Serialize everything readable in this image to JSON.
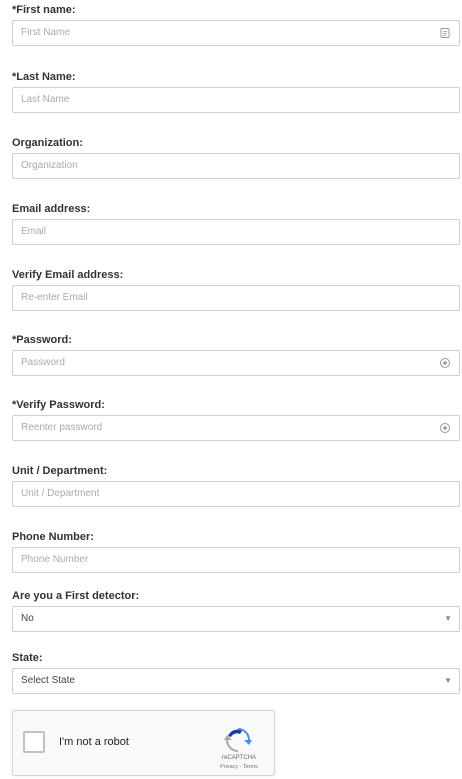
{
  "fields": [
    {
      "label": "*First name:",
      "placeholder": "First Name",
      "icon": "contact-card-icon"
    },
    {
      "label": "*Last Name:",
      "placeholder": "Last Name"
    },
    {
      "label": "Organization:",
      "placeholder": "Organization"
    },
    {
      "label": "Email address:",
      "placeholder": "Email"
    },
    {
      "label": "Verify Email address:",
      "placeholder": "Re-enter Email"
    },
    {
      "label": "*Password:",
      "placeholder": "Password",
      "icon": "password-reveal-icon"
    },
    {
      "label": "*Verify Password:",
      "placeholder": "Reenter password",
      "icon": "password-reveal-icon"
    },
    {
      "label": "Unit / Department:",
      "placeholder": "Unit / Department"
    },
    {
      "label": "Phone Number:",
      "placeholder": "Phone Number"
    }
  ],
  "first_detector": {
    "label": "Are you a First detector:",
    "value": "No"
  },
  "state": {
    "label": "State:",
    "value": "Select State"
  },
  "captcha": {
    "label": "I'm not a robot",
    "brand": "reCAPTCHA",
    "links": "Privacy - Terms",
    "checked": false
  },
  "colors": {
    "border": "#cfcfcf",
    "placeholder": "#aaaaaa",
    "label": "#333333",
    "recaptcha_blue": "#4a90e2"
  }
}
